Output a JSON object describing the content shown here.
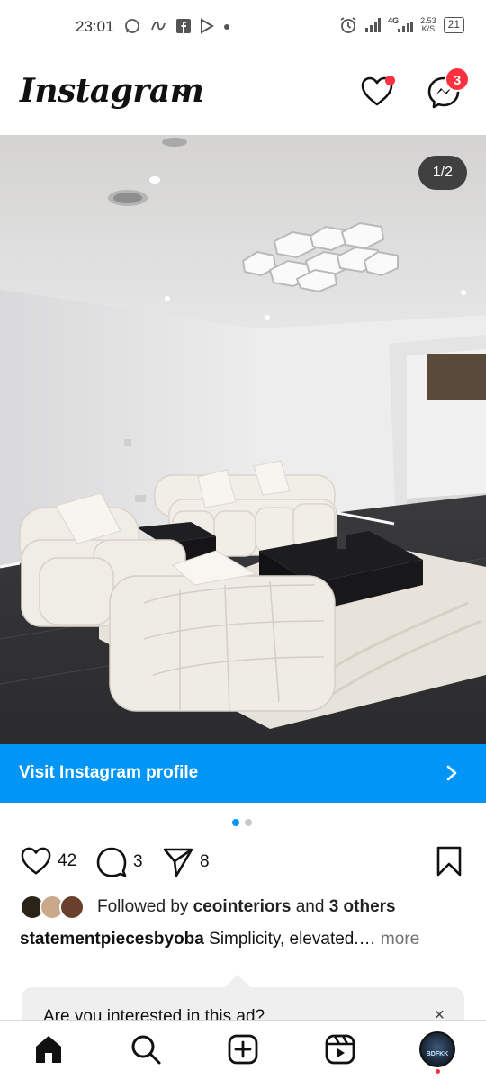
{
  "status_bar": {
    "time": "23:01",
    "app_icons": [
      "whatsapp-icon",
      "link-icon",
      "facebook-icon",
      "play-icon",
      "dot-icon"
    ],
    "network": "4G",
    "speed_value": "2.53",
    "speed_unit": "K/S",
    "battery": "21"
  },
  "header": {
    "logo": "Instagram",
    "messages_badge": "3"
  },
  "post": {
    "image_counter": "1/2",
    "cta_label": "Visit Instagram profile",
    "carousel": {
      "count": 2,
      "active": 1
    },
    "likes": "42",
    "comments": "3",
    "shares": "8",
    "followed_by_prefix": "Followed by",
    "followed_by_user": "ceointeriors",
    "followed_by_and": "and",
    "followed_by_others": "3 others",
    "username": "statementpiecesbyoba",
    "caption": "Simplicity, elevated.…",
    "more_label": "more"
  },
  "survey": {
    "question": "Are you interested in this ad?",
    "close": "×"
  },
  "bottom_nav": {
    "items": [
      "home-icon",
      "search-icon",
      "create-icon",
      "reels-icon",
      "profile-avatar"
    ],
    "avatar_text": "BDFKK"
  },
  "colors": {
    "accent": "#0095f6",
    "badge": "#ff3040"
  }
}
